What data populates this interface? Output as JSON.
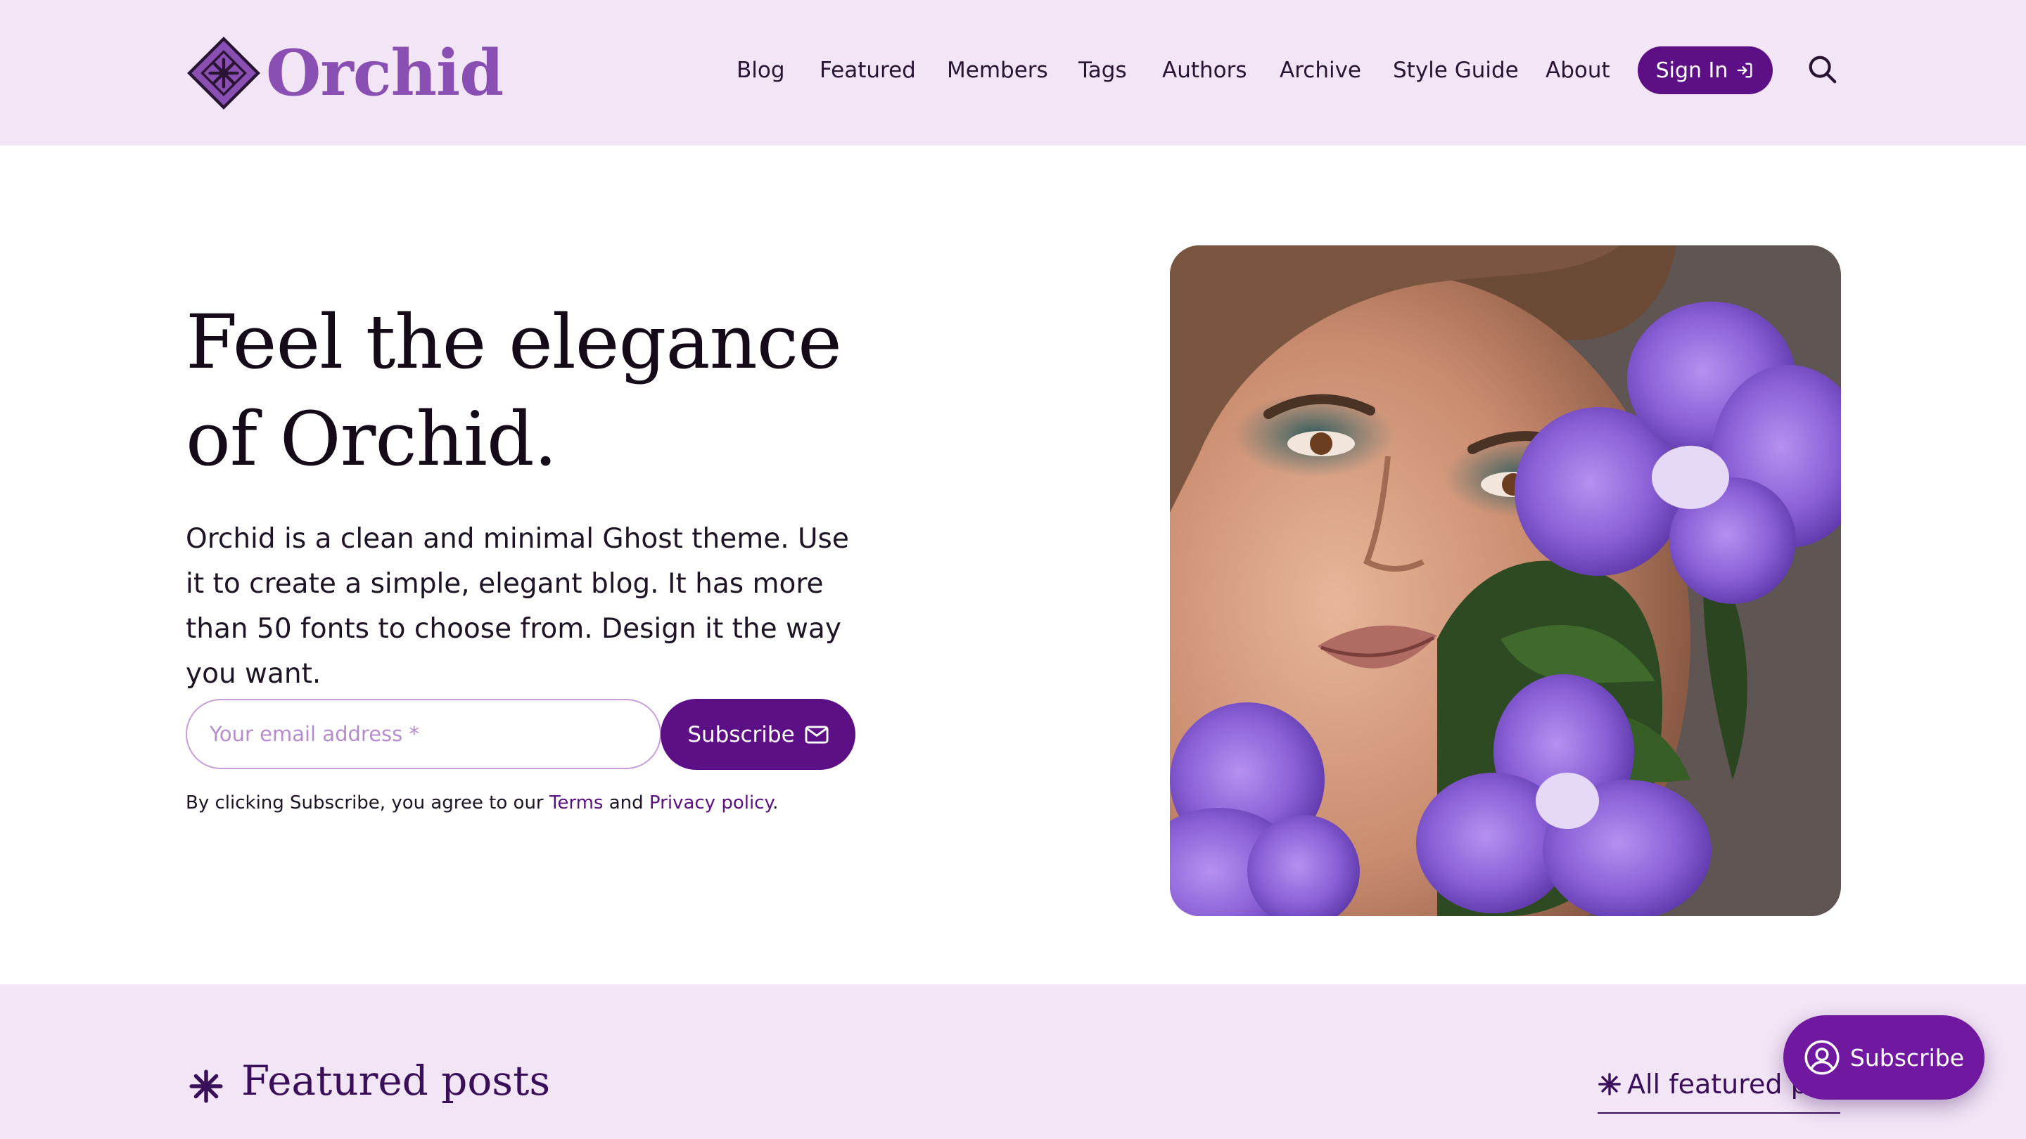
{
  "brand": {
    "name": "Orchid",
    "logo_icon": "orchid-diamond-logo",
    "color": "#8a4fb2"
  },
  "nav": {
    "items": [
      "Blog",
      "Featured",
      "Members",
      "Tags",
      "Authors",
      "Archive",
      "Style Guide",
      "About"
    ],
    "sign_in_label": "Sign In",
    "sign_in_icon": "sign-in-icon",
    "search_icon": "search-icon"
  },
  "hero": {
    "title": "Feel the elegance of Orchid.",
    "description": "Orchid is a clean and minimal Ghost theme. Use it to create a simple, elegant blog. It has more than 50 fonts to choose from. Design it the way you want.",
    "email_placeholder": "Your email address *",
    "subscribe_label": "Subscribe",
    "subscribe_icon": "envelope-icon",
    "consent_prefix": "By clicking Subscribe, you agree to our",
    "terms_label": "Terms",
    "consent_and": "and",
    "privacy_label": "Privacy policy",
    "consent_suffix": ".",
    "image_subject": "woman with teal eye makeup and purple orchids"
  },
  "featured": {
    "title": "Featured posts",
    "all_label": "All featured posts",
    "star_icon": "asterisk-star-icon"
  },
  "portal": {
    "label": "Subscribe",
    "icon": "user-circle-icon"
  },
  "colors": {
    "accent": "#5d0f86",
    "header_bg": "#f2e5f6",
    "portal_bg": "#7018a0",
    "heading_purple": "#3a0f5a"
  }
}
